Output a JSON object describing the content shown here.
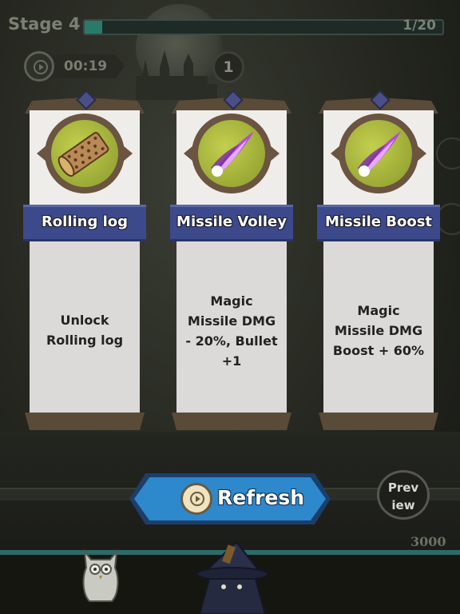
{
  "header": {
    "stage_label": "Stage 4",
    "wave_progress_text": "1/20",
    "wave_progress_fraction": 0.05
  },
  "status": {
    "timer": "00:19",
    "count": "1"
  },
  "cards": [
    {
      "title": "Rolling log",
      "description": "Unlock\nRolling log",
      "icon": "rolling-log-icon"
    },
    {
      "title": "Missile Volley",
      "description": "Magic\nMissile DMG\n- 20%, Bullet\n+1",
      "icon": "magic-missile-icon"
    },
    {
      "title": "Missile Boost",
      "description": "Magic\nMissile DMG\nBoost + 60%",
      "icon": "magic-missile-icon"
    }
  ],
  "actions": {
    "refresh_label": "Refresh",
    "preview_label": "Prev\niew"
  },
  "score": "3000",
  "colors": {
    "ribbon": "#3c4a8c",
    "refresh_button": "#2e88cc",
    "progress_fill": "#2a7a6a",
    "card_paper": "#efedea"
  }
}
